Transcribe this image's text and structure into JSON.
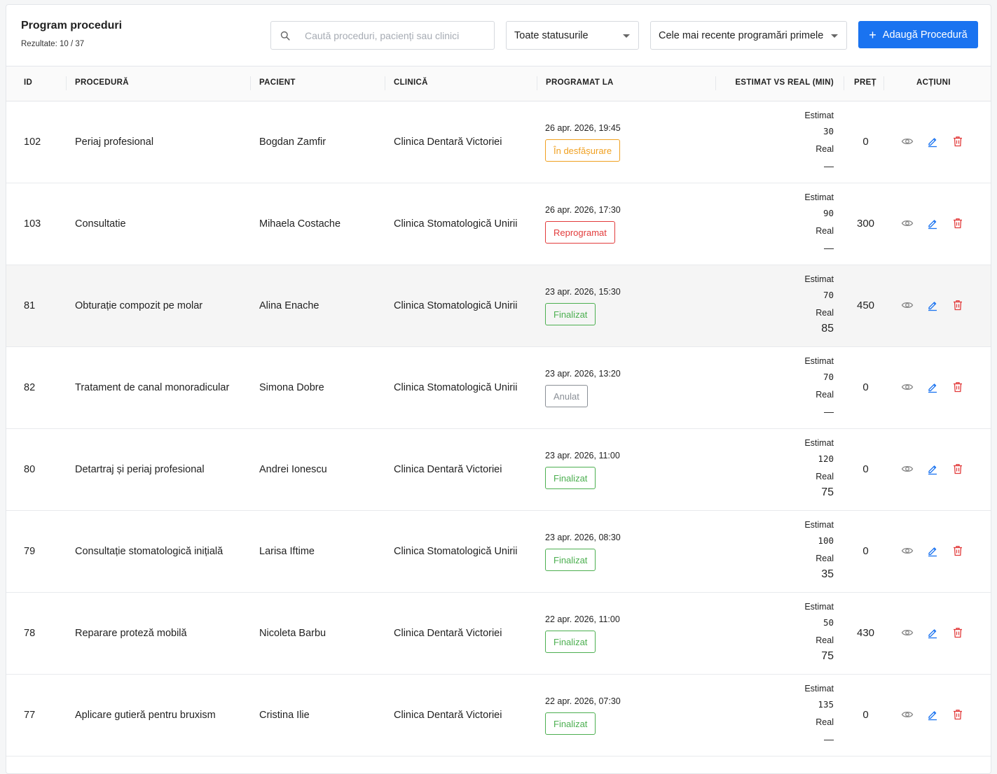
{
  "header": {
    "title": "Program proceduri",
    "results": "Rezultate: 10 / 37",
    "search_placeholder": "Caută proceduri, pacienți sau clinici",
    "status_filter": "Toate statusurile",
    "sort_filter": "Cele mai recente programări primele",
    "add_button": "Adaugă Procedură"
  },
  "columns": {
    "id": "ID",
    "procedure": "PROCEDURĂ",
    "patient": "PACIENT",
    "clinic": "CLINICĂ",
    "scheduled": "PROGRAMAT LA",
    "estimate": "ESTIMAT VS REAL (MIN)",
    "price": "PREȚ",
    "actions": "ACȚIUNI"
  },
  "labels": {
    "estimated": "Estimat",
    "real": "Real"
  },
  "status_colors": {
    "În desfășurare": "#f0a020",
    "Reprogramat": "#e23b3b",
    "Finalizat": "#4caf50",
    "Anulat": "#8a8f96"
  },
  "accent": "#1a73f0",
  "rows": [
    {
      "id": "102",
      "procedure": "Periaj profesional",
      "patient": "Bogdan Zamfir",
      "clinic": "Clinica Dentară Victoriei",
      "date": "26 apr. 2026, 19:45",
      "status": "În desfășurare",
      "estimated": "30",
      "real": "—",
      "price": "0"
    },
    {
      "id": "103",
      "procedure": "Consultatie",
      "patient": "Mihaela Costache",
      "clinic": "Clinica Stomatologică Unirii",
      "date": "26 apr. 2026, 17:30",
      "status": "Reprogramat",
      "estimated": "90",
      "real": "—",
      "price": "300"
    },
    {
      "id": "81",
      "procedure": "Obturație compozit pe molar",
      "patient": "Alina Enache",
      "clinic": "Clinica Stomatologică Unirii",
      "date": "23 apr. 2026, 15:30",
      "status": "Finalizat",
      "estimated": "70",
      "real": "85",
      "price": "450"
    },
    {
      "id": "82",
      "procedure": "Tratament de canal monoradicular",
      "patient": "Simona Dobre",
      "clinic": "Clinica Stomatologică Unirii",
      "date": "23 apr. 2026, 13:20",
      "status": "Anulat",
      "estimated": "70",
      "real": "—",
      "price": "0"
    },
    {
      "id": "80",
      "procedure": "Detartraj și periaj profesional",
      "patient": "Andrei Ionescu",
      "clinic": "Clinica Dentară Victoriei",
      "date": "23 apr. 2026, 11:00",
      "status": "Finalizat",
      "estimated": "120",
      "real": "75",
      "price": "0"
    },
    {
      "id": "79",
      "procedure": "Consultație stomatologică inițială",
      "patient": "Larisa Iftime",
      "clinic": "Clinica Stomatologică Unirii",
      "date": "23 apr. 2026, 08:30",
      "status": "Finalizat",
      "estimated": "100",
      "real": "35",
      "price": "0"
    },
    {
      "id": "78",
      "procedure": "Reparare proteză mobilă",
      "patient": "Nicoleta Barbu",
      "clinic": "Clinica Dentară Victoriei",
      "date": "22 apr. 2026, 11:00",
      "status": "Finalizat",
      "estimated": "50",
      "real": "75",
      "price": "430"
    },
    {
      "id": "77",
      "procedure": "Aplicare gutieră pentru bruxism",
      "patient": "Cristina Ilie",
      "clinic": "Clinica Dentară Victoriei",
      "date": "22 apr. 2026, 07:30",
      "status": "Finalizat",
      "estimated": "135",
      "real": "—",
      "price": "0"
    }
  ]
}
